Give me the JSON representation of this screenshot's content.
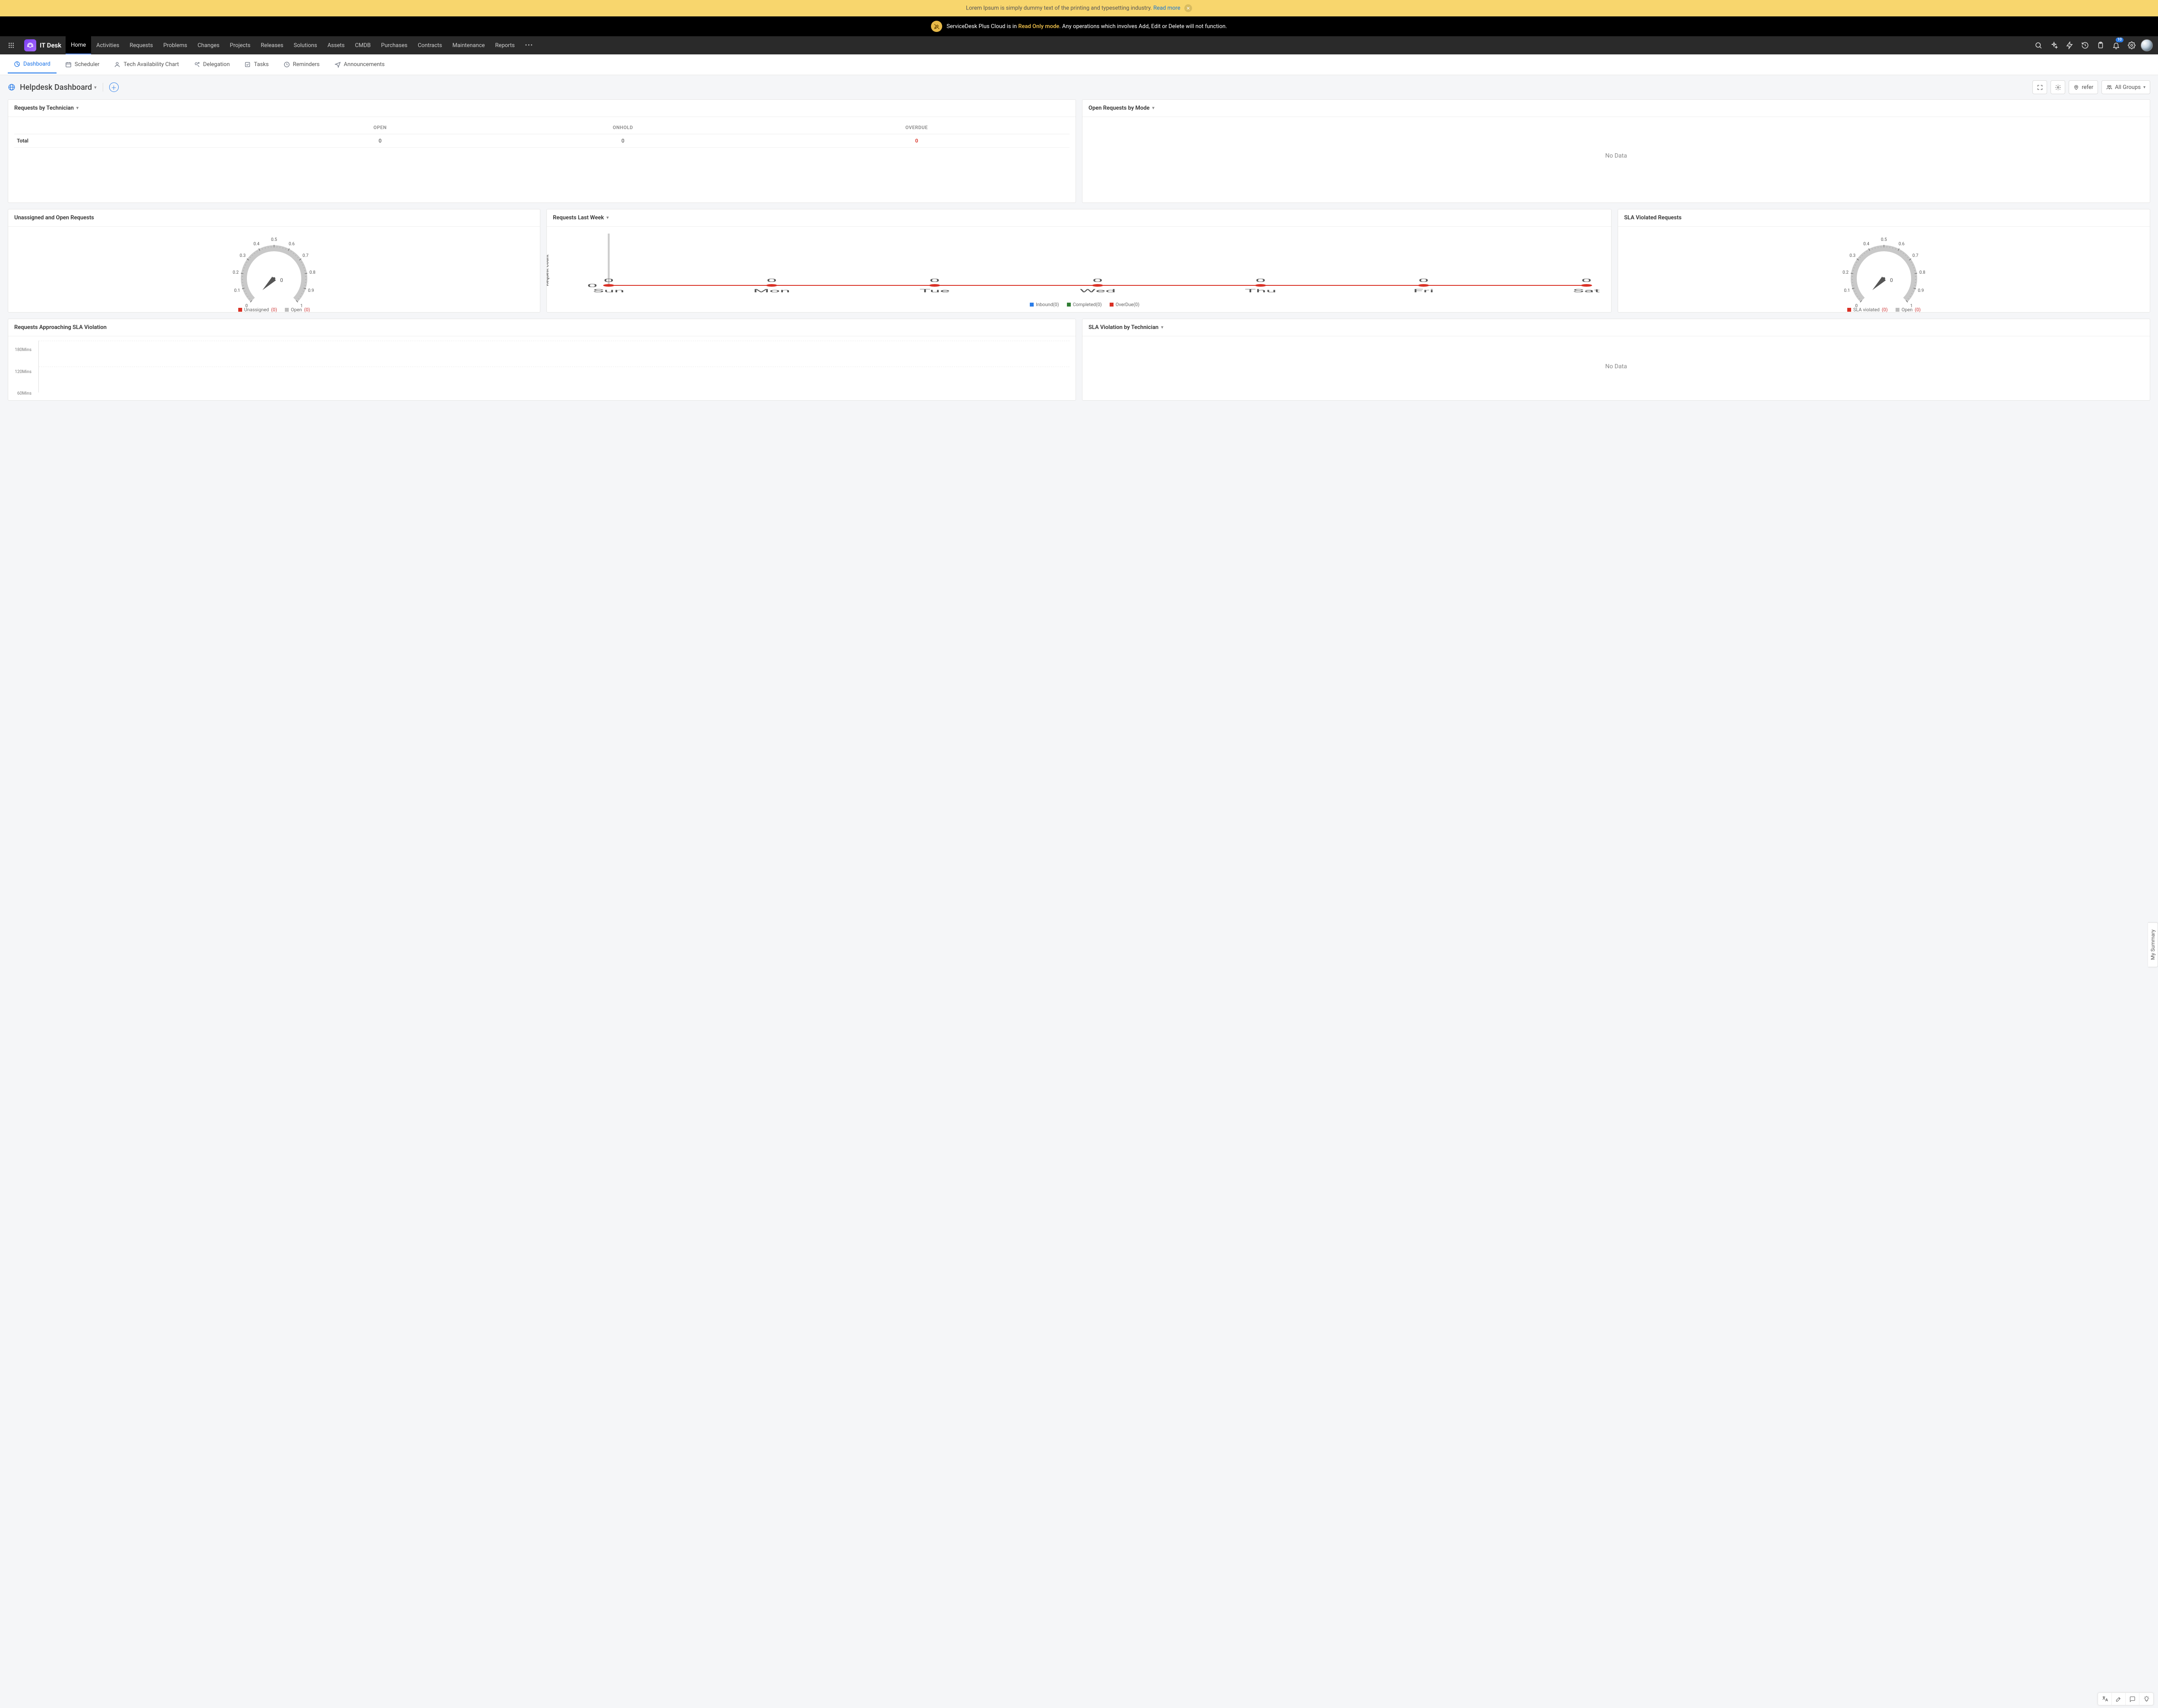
{
  "announcement": {
    "text": "Lorem Ipsum is simply dummy text of the printing and typesetting industry. ",
    "link_label": "Read more"
  },
  "readonly": {
    "prefix": "ServiceDesk Plus Cloud is in ",
    "mode": "Read Only mode",
    "suffix": ". Any operations which involves Add, Edit or Delete will not function."
  },
  "brand": "IT Desk",
  "topnav": {
    "items": [
      "Home",
      "Activities",
      "Requests",
      "Problems",
      "Changes",
      "Projects",
      "Releases",
      "Solutions",
      "Assets",
      "CMDB",
      "Purchases",
      "Contracts",
      "Maintenance",
      "Reports"
    ],
    "active": 0,
    "notification_count": "10"
  },
  "subnav": {
    "tabs": [
      "Dashboard",
      "Scheduler",
      "Tech Availability Chart",
      "Delegation",
      "Tasks",
      "Reminders",
      "Announcements"
    ],
    "active": 0
  },
  "dashboardTitle": "Helpdesk Dashboard",
  "titleActions": {
    "refer": "refer",
    "groups": "All Groups"
  },
  "cards": {
    "requestsByTechnician": {
      "title": "Requests by Technician",
      "columns": [
        "OPEN",
        "ONHOLD",
        "OVERDUE"
      ],
      "rowLabel": "Total",
      "values": [
        "0",
        "0",
        "0"
      ]
    },
    "openRequestsByMode": {
      "title": "Open Requests by Mode",
      "empty": "No Data"
    },
    "unassigned": {
      "title": "Unassigned and Open Requests",
      "legend": [
        {
          "label": "Unassigned",
          "count": "(0)",
          "color": "#d93025"
        },
        {
          "label": "Open",
          "count": "(0)",
          "color": "#bdbdbd"
        }
      ],
      "center": "0"
    },
    "lastWeek": {
      "title": "Requests Last Week",
      "yLabel": "Request Count",
      "legend": [
        {
          "label": "Inbound(0)",
          "color": "#2b7de9"
        },
        {
          "label": "Completed(0)",
          "color": "#2e7d32"
        },
        {
          "label": "OverDue(0)",
          "color": "#d93025"
        }
      ]
    },
    "slaViolated": {
      "title": "SLA Violated Requests",
      "legend": [
        {
          "label": "SLA violated",
          "count": "(0)",
          "color": "#d93025"
        },
        {
          "label": "Open",
          "count": "(0)",
          "color": "#bdbdbd"
        }
      ],
      "center": "0"
    },
    "approaching": {
      "title": "Requests Approaching SLA Violation",
      "yticks": [
        "180Mins",
        "120Mins",
        "60Mins"
      ]
    },
    "slaByTech": {
      "title": "SLA Violation by Technician",
      "empty": "No Data"
    }
  },
  "floattab": "My Summary",
  "chart_data": [
    {
      "type": "line",
      "name": "Requests Last Week",
      "xlabel": "",
      "ylabel": "Request Count",
      "categories": [
        "Sun",
        "Mon",
        "Tue",
        "Wed",
        "Thu",
        "Fri",
        "Sat"
      ],
      "series": [
        {
          "name": "Inbound",
          "values": [
            0,
            0,
            0,
            0,
            0,
            0,
            0
          ]
        },
        {
          "name": "Completed",
          "values": [
            0,
            0,
            0,
            0,
            0,
            0,
            0
          ]
        },
        {
          "name": "OverDue",
          "values": [
            0,
            0,
            0,
            0,
            0,
            0,
            0
          ]
        }
      ],
      "ylim": [
        0,
        1
      ],
      "yticks": [
        0
      ]
    },
    {
      "type": "gauge",
      "name": "Unassigned and Open Requests",
      "ticks": [
        0,
        0.1,
        0.2,
        0.3,
        0.4,
        0.5,
        0.6,
        0.7,
        0.8,
        0.9,
        1
      ],
      "series": [
        {
          "name": "Unassigned",
          "value": 0
        },
        {
          "name": "Open",
          "value": 0
        }
      ],
      "value": 0
    },
    {
      "type": "gauge",
      "name": "SLA Violated Requests",
      "ticks": [
        0,
        0.1,
        0.2,
        0.3,
        0.4,
        0.5,
        0.6,
        0.7,
        0.8,
        0.9,
        1
      ],
      "series": [
        {
          "name": "SLA violated",
          "value": 0
        },
        {
          "name": "Open",
          "value": 0
        }
      ],
      "value": 0
    },
    {
      "type": "bar",
      "name": "Requests Approaching SLA Violation",
      "yticks_labels": [
        "60Mins",
        "120Mins",
        "180Mins"
      ],
      "categories": [],
      "values": []
    }
  ]
}
